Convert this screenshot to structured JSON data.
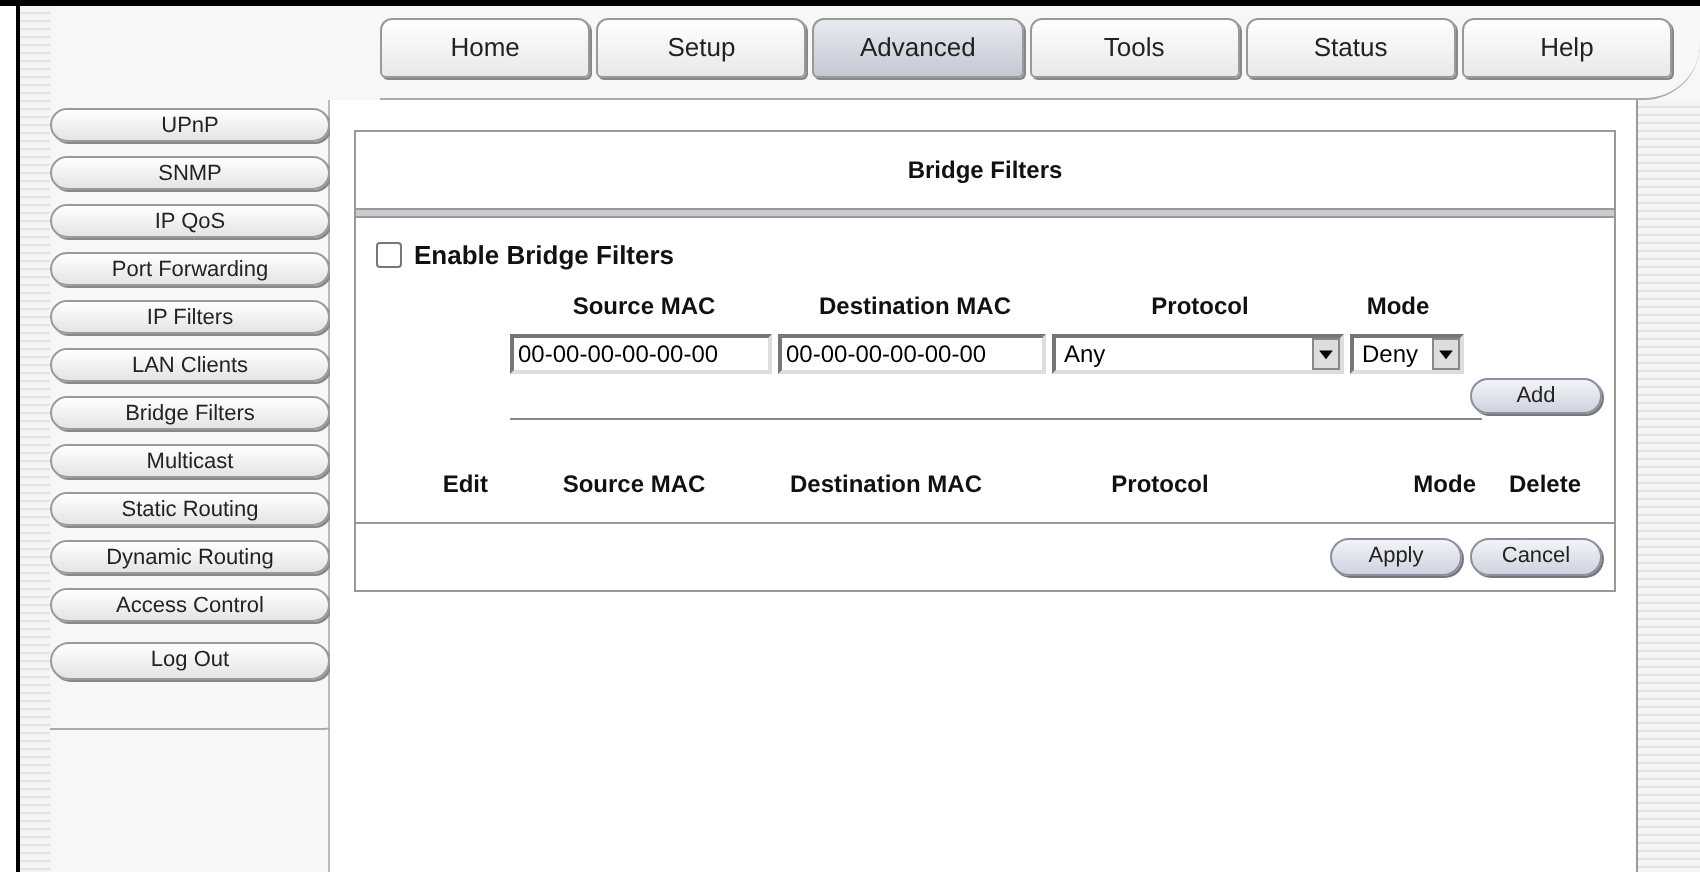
{
  "tabs": [
    {
      "label": "Home",
      "selected": false
    },
    {
      "label": "Setup",
      "selected": false
    },
    {
      "label": "Advanced",
      "selected": true
    },
    {
      "label": "Tools",
      "selected": false
    },
    {
      "label": "Status",
      "selected": false
    },
    {
      "label": "Help",
      "selected": false
    }
  ],
  "sidebar": {
    "items": [
      "UPnP",
      "SNMP",
      "IP QoS",
      "Port Forwarding",
      "IP Filters",
      "LAN Clients",
      "Bridge Filters",
      "Multicast",
      "Static Routing",
      "Dynamic Routing",
      "Access Control"
    ],
    "logout": "Log Out"
  },
  "panel": {
    "title": "Bridge Filters",
    "enable": {
      "label": "Enable Bridge Filters",
      "checked": false
    },
    "form_columns": [
      "Source MAC",
      "Destination MAC",
      "Protocol",
      "Mode"
    ],
    "source_mac": "00-00-00-00-00-00",
    "destination_mac": "00-00-00-00-00-00",
    "protocol": "Any",
    "mode": "Deny",
    "add": "Add",
    "table_columns": [
      "Edit",
      "Source MAC",
      "Destination MAC",
      "Protocol",
      "Mode",
      "Delete"
    ],
    "buttons": [
      "Apply",
      "Cancel"
    ]
  }
}
